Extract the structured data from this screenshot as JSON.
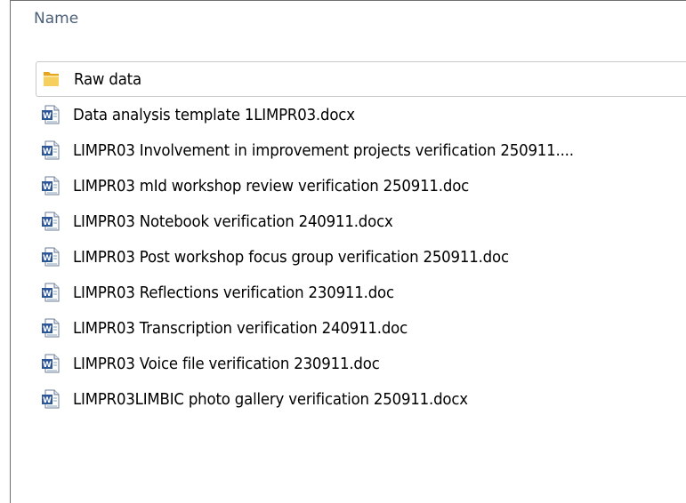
{
  "header": {
    "name_column": "Name"
  },
  "files": [
    {
      "label": "Raw data",
      "icon": "folder-icon",
      "type": "folder"
    },
    {
      "label": "Data analysis template 1LIMPR03.docx",
      "icon": "word-document-icon",
      "type": "document"
    },
    {
      "label": "LIMPR03 Involvement in improvement projects verification 250911....",
      "icon": "word-document-icon",
      "type": "document"
    },
    {
      "label": "LIMPR03 mId workshop review verification 250911.doc",
      "icon": "word-document-icon",
      "type": "document"
    },
    {
      "label": "LIMPR03 Notebook verification 240911.docx",
      "icon": "word-document-icon",
      "type": "document"
    },
    {
      "label": "LIMPR03 Post workshop focus group verification 250911.doc",
      "icon": "word-document-icon",
      "type": "document"
    },
    {
      "label": "LIMPR03 Reflections verification 230911.doc",
      "icon": "word-document-icon",
      "type": "document"
    },
    {
      "label": "LIMPR03 Transcription verification 240911.doc",
      "icon": "word-document-icon",
      "type": "document"
    },
    {
      "label": "LIMPR03 Voice file verification 230911.doc",
      "icon": "word-document-icon",
      "type": "document"
    },
    {
      "label": "LIMPR03LIMBIC photo gallery verification 250911.docx",
      "icon": "word-document-icon",
      "type": "document"
    }
  ],
  "colors": {
    "header_text": "#4c607a",
    "folder_yellow": "#f2c14e",
    "word_blue": "#2b5797"
  }
}
